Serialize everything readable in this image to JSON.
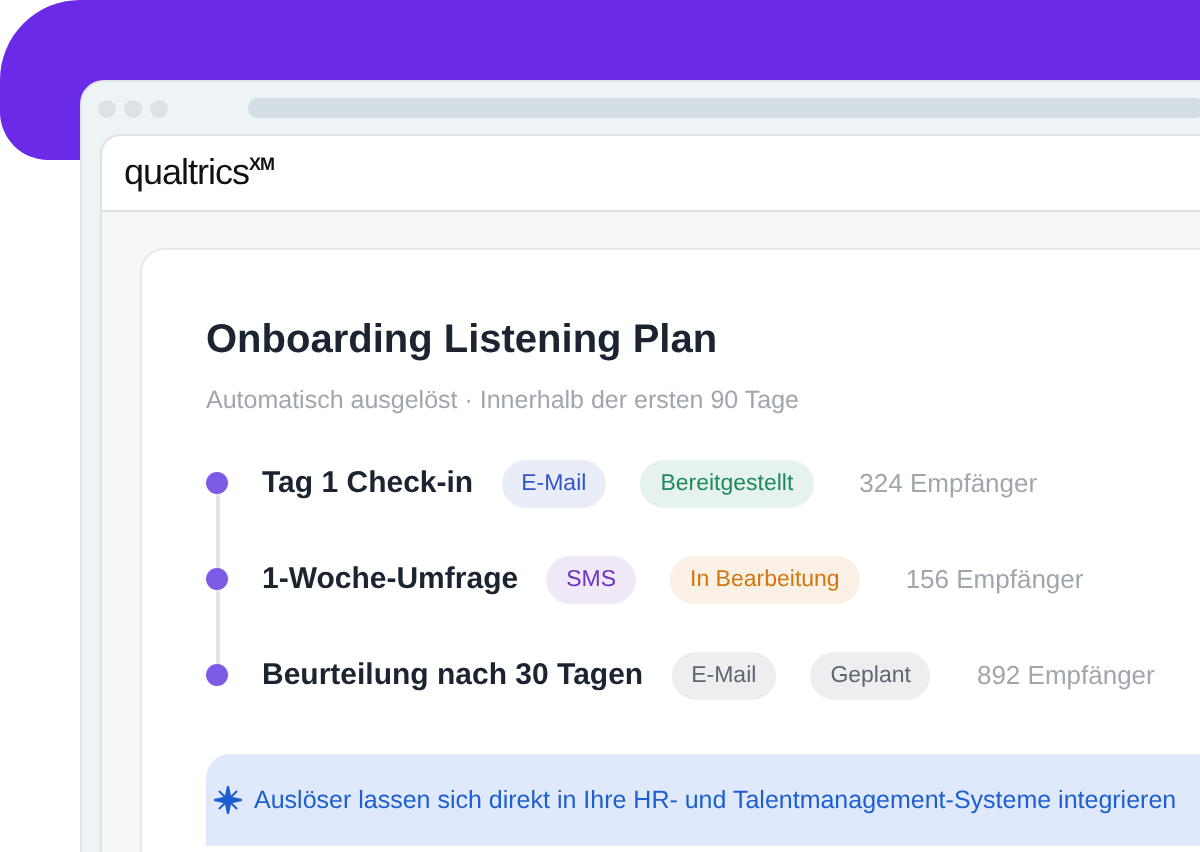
{
  "logo": "qualtrics$^{XM}$",
  "plan": {
    "title": "Onboarding Listening Plan",
    "subtitle": "Automatisch ausgelöst · Innerhalb der ersten 90 Tage",
    "steps": [
      {
        "name": "Tag 1 Check-in",
        "chips": [
          {
            "label": "E-Mail",
            "color": "#3356c4"
          },
          {
            "label": "Bereitgestellt",
            "color": "#1f8a5b"
          }
        ],
        "recipients": "324 Empfänger"
      },
      {
        "name": "1-Woche-Umfrage",
        "chips": [
          {
            "label": "SMS",
            "color": "#6d35c2"
          },
          {
            "label": "In Bearbeitung",
            "color": "#d2750f"
          }
        ],
        "recipients": "156 Empfänger"
      },
      {
        "name": "Beurteilung nach 30 Tagen",
        "chips": [
          {
            "label": "E-Mail",
            "color": "#5f6670"
          },
          {
            "label": "Geplant",
            "color": "#5f6670"
          }
        ],
        "recipients": "892 Empfänger"
      }
    ],
    "banner": "Auslöser lassen sich direkt in Ihre HR- und Talentmanagement-Systeme integrieren"
  }
}
